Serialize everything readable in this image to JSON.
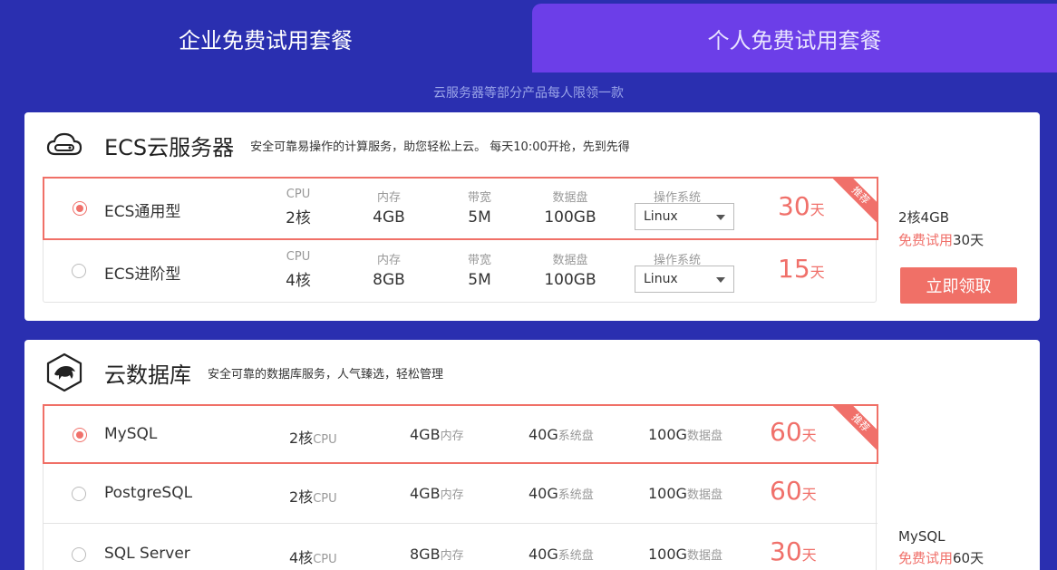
{
  "tabs": {
    "enterprise": "企业免费试用套餐",
    "personal": "个人免费试用套餐"
  },
  "subtitle": "云服务器等部分产品每人限领一款",
  "ribbon_label": "推荐",
  "ecs": {
    "title": "ECS云服务器",
    "desc": "安全可靠易操作的计算服务，助您轻松上云。 每天10:00开抢，先到先得",
    "spec_labels": {
      "cpu": "CPU",
      "mem": "内存",
      "bw": "带宽",
      "disk": "数据盘",
      "os": "操作系统"
    },
    "plans": [
      {
        "name": "ECS通用型",
        "cpu": "2核",
        "mem": "4GB",
        "bw": "5M",
        "disk": "100GB",
        "os": "Linux",
        "days": "30",
        "unit": "天",
        "selected": true
      },
      {
        "name": "ECS进阶型",
        "cpu": "4核",
        "mem": "8GB",
        "bw": "5M",
        "disk": "100GB",
        "os": "Linux",
        "days": "15",
        "unit": "天",
        "selected": false
      }
    ],
    "summary": {
      "spec": "2核4GB",
      "free_label": "免费试用",
      "days": "30天"
    },
    "claim_button": "立即领取"
  },
  "db": {
    "title": "云数据库",
    "desc": "安全可靠的数据库服务，人气臻选，轻松管理",
    "unit_labels": {
      "cpu": "CPU",
      "mem": "内存",
      "sys": "系统盘",
      "data": "数据盘"
    },
    "plans": [
      {
        "name": "MySQL",
        "cpu": "2核",
        "mem": "4GB",
        "sys": "40G",
        "data": "100G",
        "days": "60",
        "unit": "天",
        "selected": true
      },
      {
        "name": "PostgreSQL",
        "cpu": "2核",
        "mem": "4GB",
        "sys": "40G",
        "data": "100G",
        "days": "60",
        "unit": "天",
        "selected": false
      },
      {
        "name": "SQL Server",
        "cpu": "4核",
        "mem": "8GB",
        "sys": "40G",
        "data": "100G",
        "days": "30",
        "unit": "天",
        "selected": false
      }
    ],
    "summary": {
      "name": "MySQL",
      "free_label": "免费试用",
      "days": "60天"
    }
  },
  "colors": {
    "background": "#2a2fb0",
    "personal_tab": "#6c3ee8",
    "accent": "#f0706a"
  }
}
